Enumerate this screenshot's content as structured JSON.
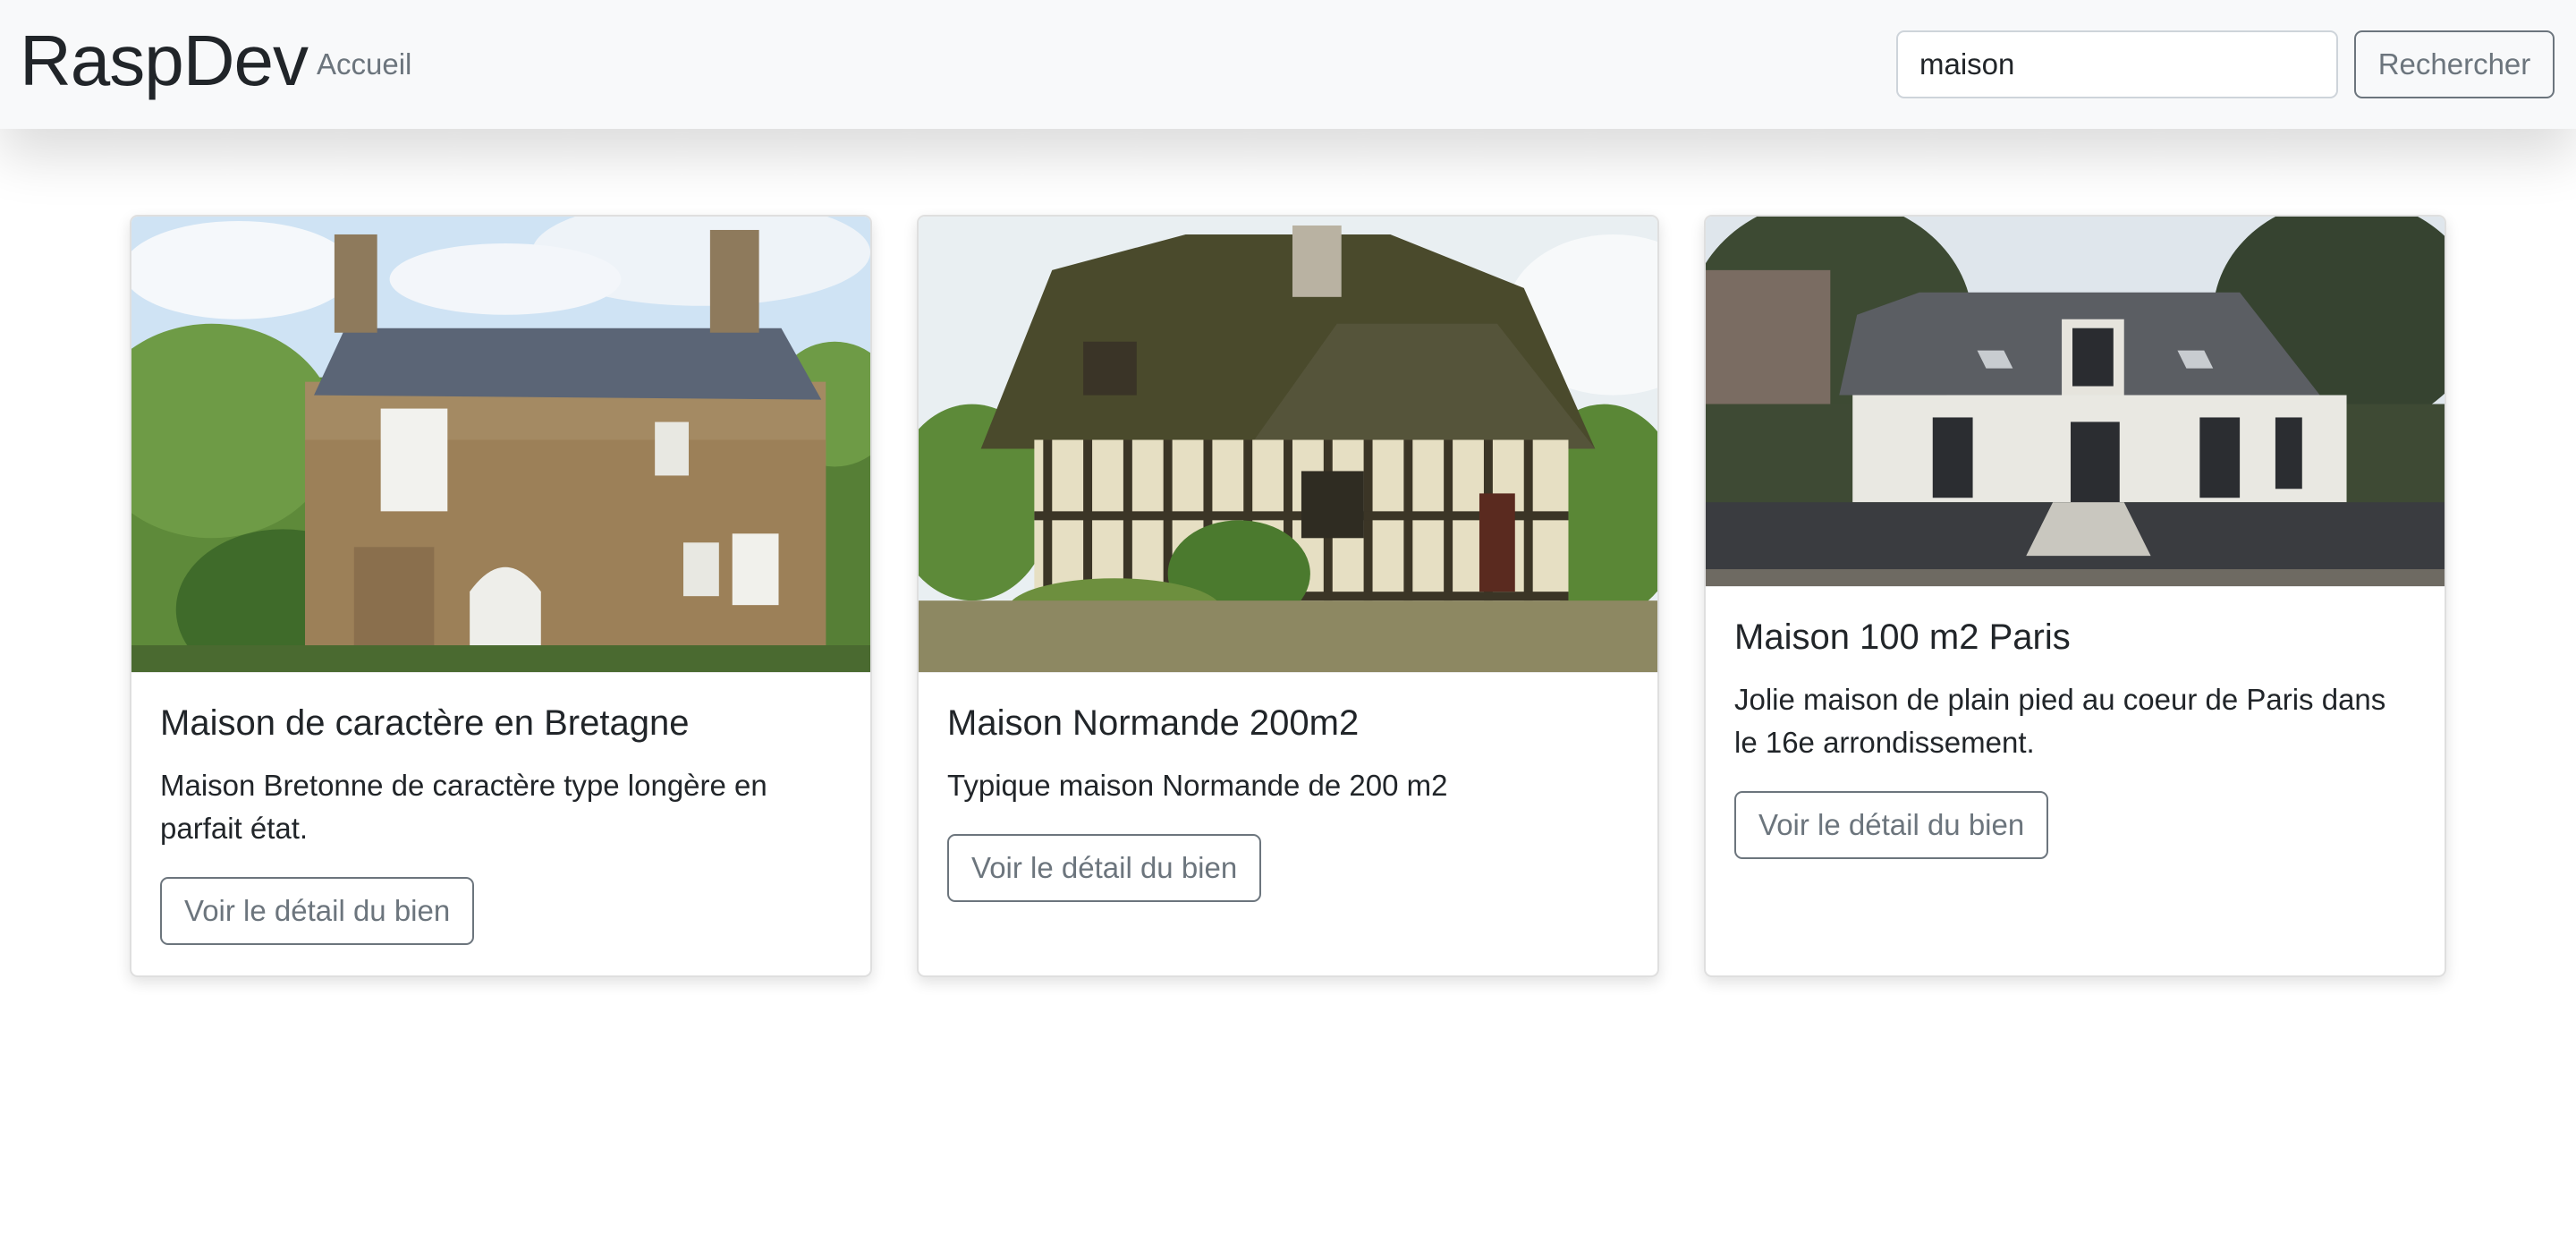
{
  "navbar": {
    "brand": "RaspDev",
    "home_link": "Accueil",
    "search": {
      "value": "maison",
      "button_label": "Rechercher"
    }
  },
  "listings": [
    {
      "title": "Maison de caractère en Bretagne",
      "description": "Maison Bretonne de caractère type longère en parfait état.",
      "button_label": "Voir le détail du bien"
    },
    {
      "title": "Maison Normande 200m2",
      "description": "Typique maison Normande de 200 m2",
      "button_label": "Voir le détail du bien"
    },
    {
      "title": "Maison 100 m2 Paris",
      "description": "Jolie maison de plain pied au coeur de Paris dans le 16e arrondissement.",
      "button_label": "Voir le détail du bien"
    }
  ],
  "colors": {
    "navbar_bg": "#f8f9fa",
    "secondary": "#6c757d",
    "text": "#212529"
  }
}
